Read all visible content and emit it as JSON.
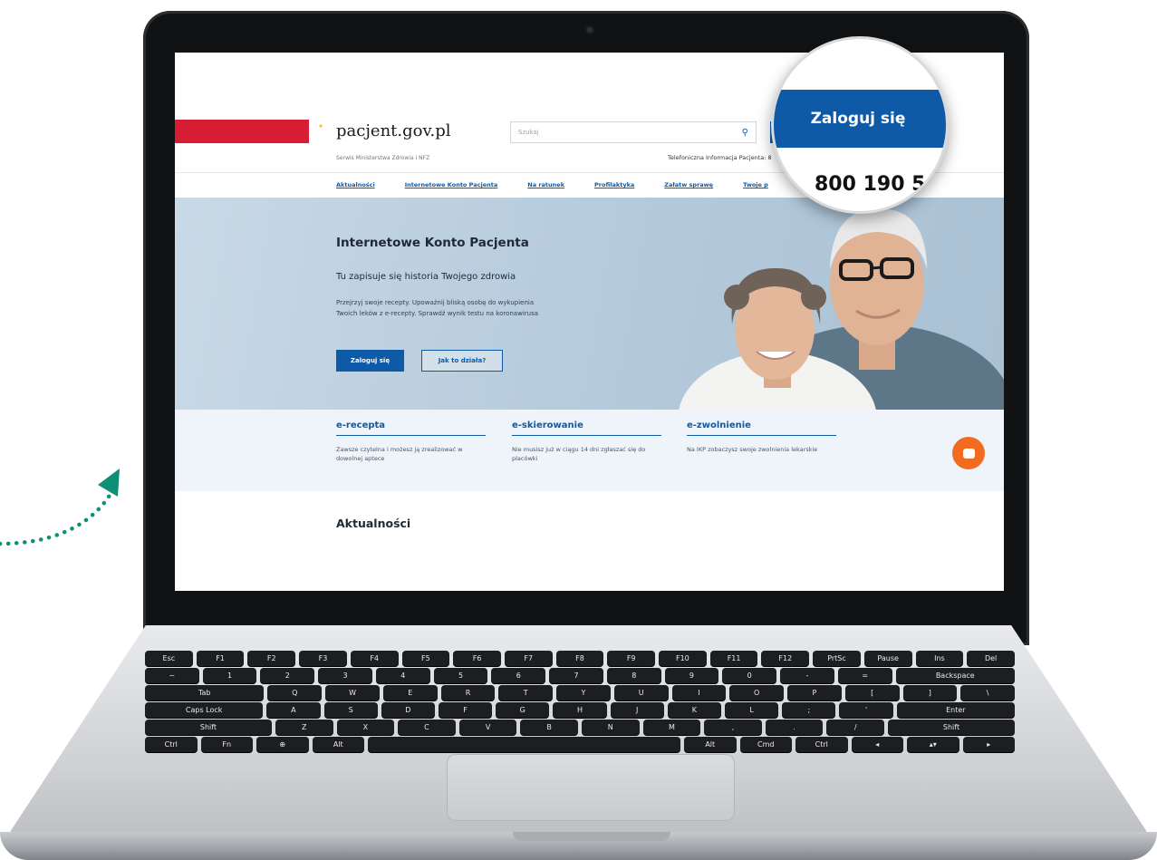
{
  "site": {
    "brand": "pacjent.gov.pl",
    "brand_subtitle": "Serwis Ministerstwa Zdrowia i NFZ",
    "search_placeholder": "Szukaj",
    "phone_info": "Telefoniczna Informacja Pacjenta: 8",
    "nav": [
      {
        "label": "Aktualności"
      },
      {
        "label": "Internetowe Konto Pacjenta"
      },
      {
        "label": "Na ratunek"
      },
      {
        "label": "Profilaktyka"
      },
      {
        "label": "Załatw sprawę"
      },
      {
        "label": "Twoje p"
      }
    ],
    "hero": {
      "title": "Internetowe Konto Pacjenta",
      "subtitle": "Tu zapisuje się historia Twojego zdrowia",
      "description": "Przejrzyj swoje recepty. Upoważnij bliską osobę do wykupienia Twoich leków z e-recepty. Sprawdź wynik testu na koronawirusa",
      "login_button": "Zaloguj się",
      "how_button": "Jak to działa?"
    },
    "cards": [
      {
        "title": "e-recepta",
        "text": "Zawsze czytelna i możesz ją zrealizować w dowolnej aptece"
      },
      {
        "title": "e-skierowanie",
        "text": "Nie musisz już w ciągu 14 dni zgłaszać się do placówki"
      },
      {
        "title": "e-zwolnienie",
        "text": "Na IKP zobaczysz swoje zwolnienia lekarskie"
      }
    ],
    "news_heading": "Aktualności"
  },
  "magnifier": {
    "button": "Zaloguj się",
    "phone": "800 190 5"
  },
  "keyboard": {
    "row1": [
      "Esc",
      "F1",
      "F2",
      "F3",
      "F4",
      "F5",
      "F6",
      "F7",
      "F8",
      "F9",
      "F10",
      "F11",
      "F12",
      "PrtSc",
      "Pause",
      "Ins",
      "Del"
    ],
    "row2": [
      "~",
      "1",
      "2",
      "3",
      "4",
      "5",
      "6",
      "7",
      "8",
      "9",
      "0",
      "-",
      "=",
      "Backspace"
    ],
    "row3": [
      "Tab",
      "Q",
      "W",
      "E",
      "R",
      "T",
      "Y",
      "U",
      "I",
      "O",
      "P",
      "[",
      "]",
      "\\"
    ],
    "row4": [
      "Caps Lock",
      "A",
      "S",
      "D",
      "F",
      "G",
      "H",
      "J",
      "K",
      "L",
      ";",
      "'",
      "Enter"
    ],
    "row5": [
      "Shift",
      "Z",
      "X",
      "C",
      "V",
      "B",
      "N",
      "M",
      ",",
      ".",
      "/",
      "Shift"
    ],
    "row6": [
      "Ctrl",
      "Fn",
      "⊕",
      "Alt",
      "",
      "Alt",
      "Cmd",
      "Ctrl",
      "◂",
      "▴▾",
      "▸"
    ]
  },
  "colors": {
    "brand_blue": "#0e5aa6",
    "brand_red": "#d71d33",
    "chat_orange": "#f26b21",
    "arrow_green": "#0f8f73"
  }
}
